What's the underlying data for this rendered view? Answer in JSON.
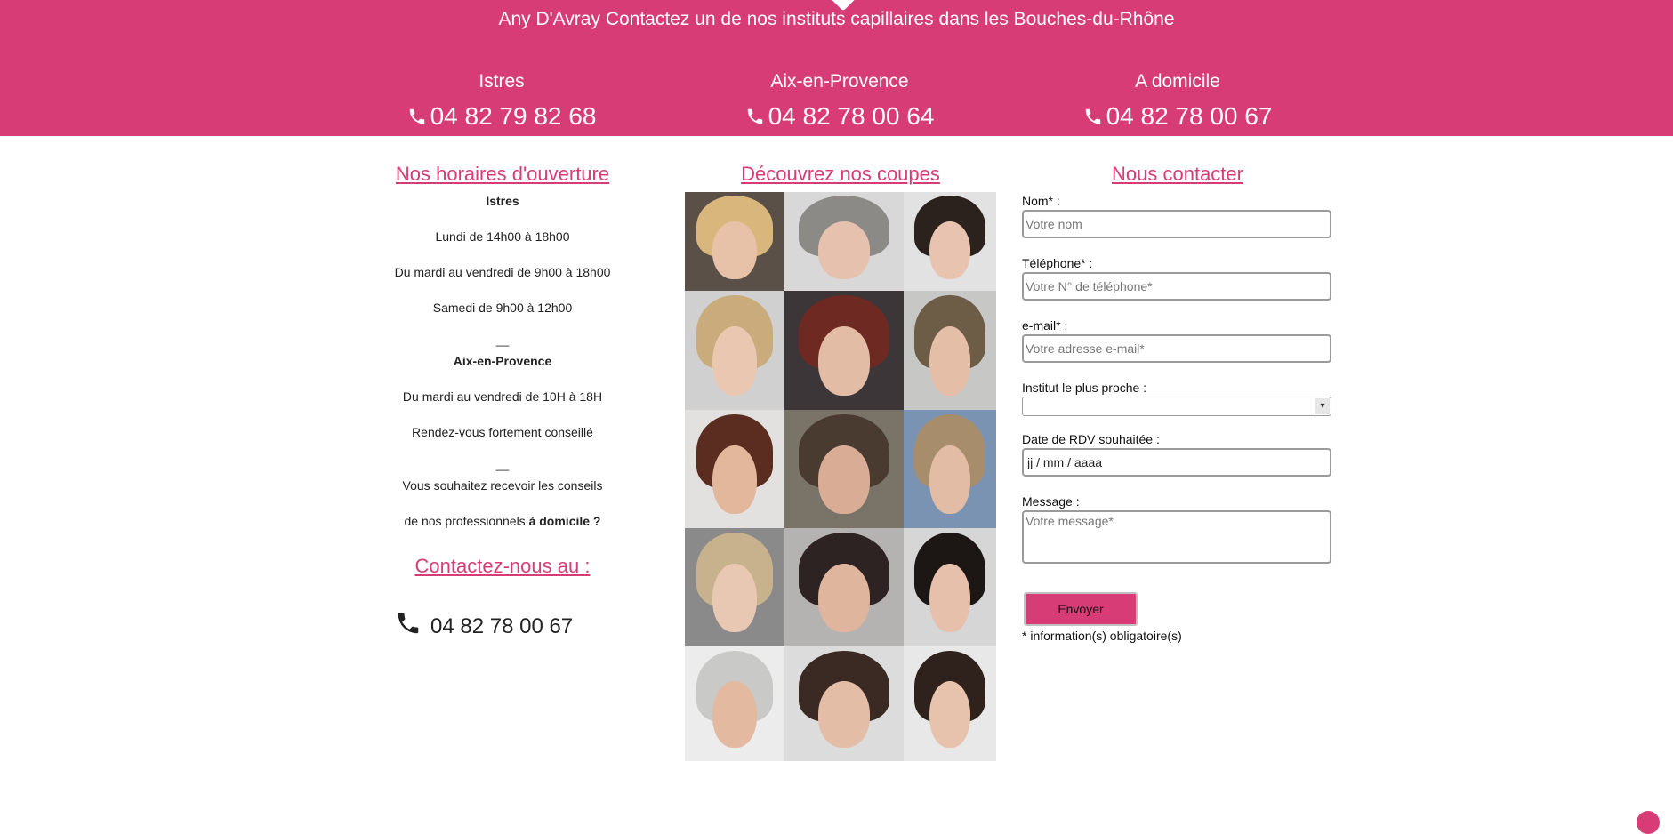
{
  "header": {
    "tagline": "Any D'Avray Contactez un de nos instituts capillaires dans les Bouches-du-Rhône",
    "offices": [
      {
        "name": "Istres",
        "phone": "04 82 79 82 68"
      },
      {
        "name": "Aix-en-Provence",
        "phone": "04 82 78 00 64"
      },
      {
        "name": "A domicile",
        "phone": "04 82 78 00 67"
      }
    ],
    "background_color": "#d83c76"
  },
  "hours": {
    "title": "Nos horaires d'ouverture",
    "istres_name": "Istres",
    "istres_lines": [
      "Lundi de 14h00 à 18h00",
      "Du mardi au vendredi de 9h00 à 18h00",
      "Samedi de 9h00 à 12h00"
    ],
    "separator": "__",
    "aix_name": "Aix-en-Provence",
    "aix_lines": [
      "Du mardi au vendredi de 10H à 18H",
      "Rendez-vous fortement conseillé"
    ],
    "home_line1": "Vous souhaitez recevoir les conseils",
    "home_line2_prefix": "de nos professionnels ",
    "home_line2_bold": "à domicile ?"
  },
  "contact_phone": {
    "title": "Contactez-nous au :",
    "phone": "04 82 78 00 67"
  },
  "gallery": {
    "title": "Découvrez nos coupes"
  },
  "form": {
    "title": "Nous contacter",
    "name_label": "Nom* :",
    "name_placeholder": "Votre nom",
    "phone_label": "Téléphone* :",
    "phone_placeholder": "Votre N° de téléphone*",
    "email_label": "e-mail* :",
    "email_placeholder": "Votre adresse e-mail*",
    "institute_label": "Institut le plus proche :",
    "institute_value": "",
    "date_label": "Date de RDV souhaitée :",
    "date_value": "jj / mm / aaaa",
    "message_label": "Message :",
    "message_placeholder": "Votre message*",
    "submit_label": "Envoyer",
    "required_note": "* information(s) obligatoire(s)"
  },
  "colors": {
    "accent": "#d83c76",
    "text": "#222222"
  }
}
